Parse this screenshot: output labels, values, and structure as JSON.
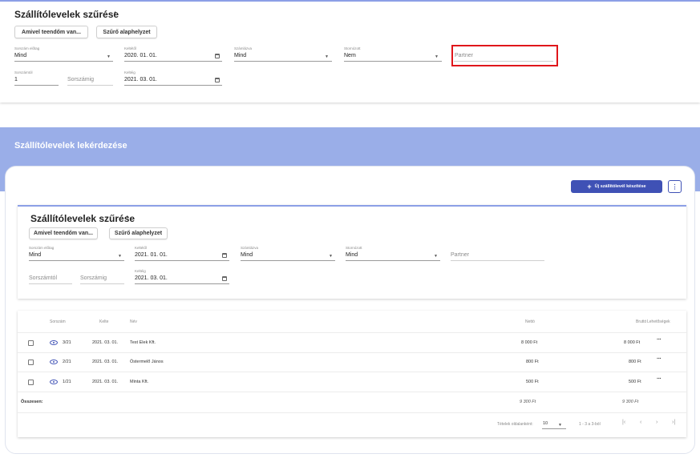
{
  "top_filter": {
    "title": "Szállítólevelek szűrése",
    "btn_todo": "Amivel teendőm van...",
    "btn_reset": "Szűrő alaphelyzet",
    "prefix_label": "Sorszám előtag",
    "prefix_value": "Mind",
    "from_label": "Keltétől",
    "from_value": "2020. 01. 01.",
    "invoiced_label": "Számlázva",
    "invoiced_value": "Mind",
    "storno_label": "Stornózott",
    "storno_value": "Nem",
    "partner_placeholder": "Partner",
    "num_from_label": "Sorszámtól",
    "num_from_value": "1",
    "num_to_placeholder": "Sorszámig",
    "to_label": "Keltéig",
    "to_value": "2021. 03. 01."
  },
  "page": {
    "title": "Szállítólevelek lekérdezése",
    "new_button": "Új szállítólevél készítése"
  },
  "inner_filter": {
    "title": "Szállítólevelek szűrése",
    "btn_todo": "Amivel teendőm van...",
    "btn_reset": "Szűrő alaphelyzet",
    "prefix_label": "Sorszám előtag",
    "prefix_value": "Mind",
    "from_label": "Keltétől",
    "from_value": "2021. 01. 01.",
    "invoiced_label": "Számlázva",
    "invoiced_value": "Mind",
    "storno_label": "Stornózott",
    "storno_value": "Mind",
    "partner_placeholder": "Partner",
    "num_from_placeholder": "Sorszámtól",
    "num_to_placeholder": "Sorszámig",
    "to_label": "Keltéig",
    "to_value": "2021. 03. 01."
  },
  "table": {
    "headers": {
      "number": "Sorszám",
      "date": "Kelte",
      "name": "Név",
      "net": "Nettó",
      "gross": "Bruttó",
      "actions": "Lehetőségek"
    },
    "rows": [
      {
        "number": "3/21",
        "date": "2021. 03. 01.",
        "name": "Test Elek Kft.",
        "net": "8 000 Ft",
        "gross": "8 000 Ft"
      },
      {
        "number": "2/21",
        "date": "2021. 03. 01.",
        "name": "Östermelő János",
        "net": "800 Ft",
        "gross": "800 Ft"
      },
      {
        "number": "1/21",
        "date": "2021. 03. 01.",
        "name": "Minta Kft.",
        "net": "500 Ft",
        "gross": "500 Ft"
      }
    ],
    "total_label": "Összesen:",
    "total_net": "9 300 Ft",
    "total_gross": "9 300 Ft",
    "page_size_label": "Tételek oldalanként:",
    "page_size_value": "10",
    "range_text": "1 - 3 a 3-ból"
  },
  "colors": {
    "accent": "#3f51b5",
    "band": "#9aaee8",
    "highlight": "#e0161b"
  }
}
